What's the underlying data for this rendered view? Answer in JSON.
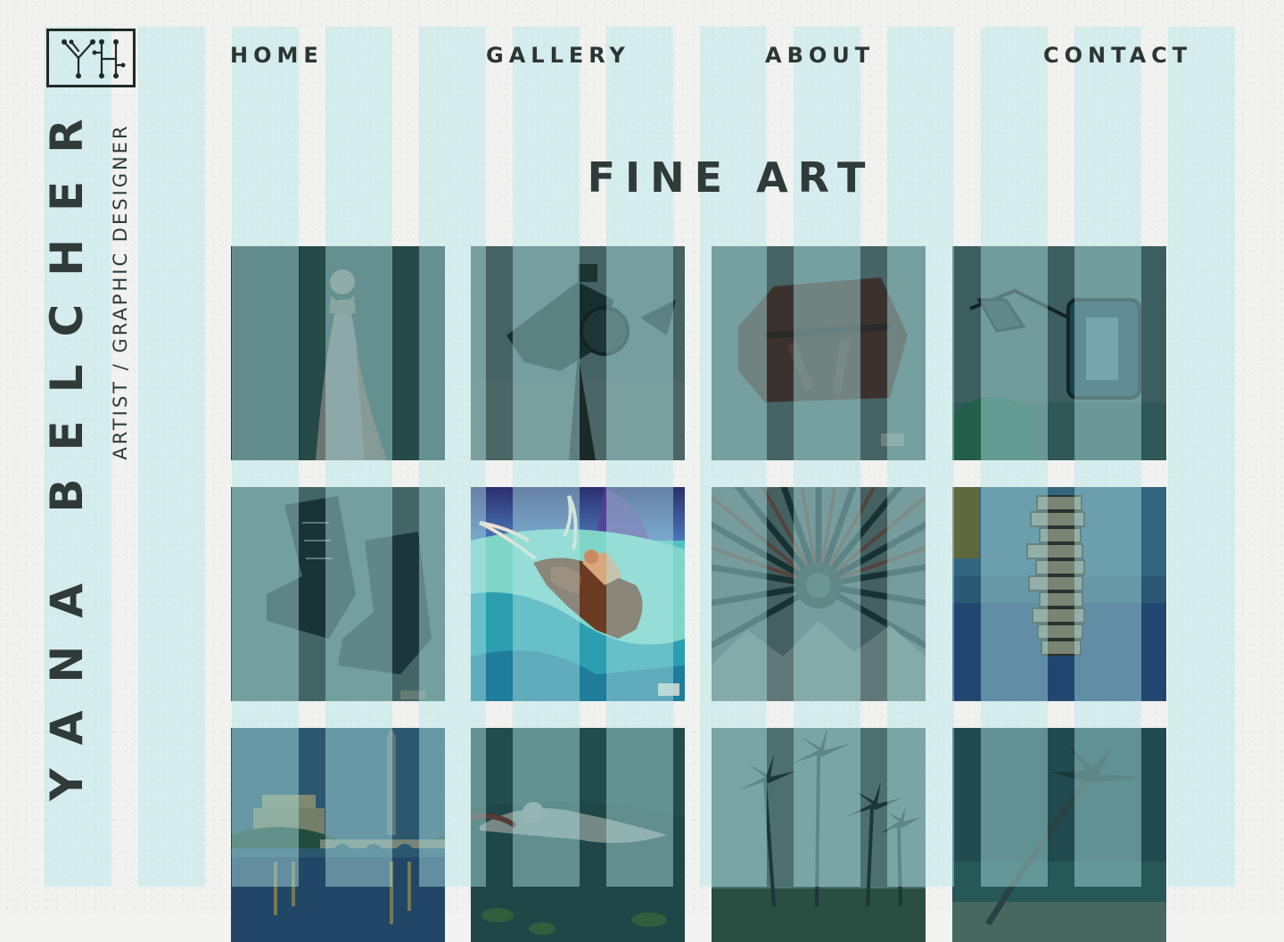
{
  "brand": {
    "name": "YANA BELCHER",
    "tagline": "ARTIST / GRAPHIC DESIGNER"
  },
  "nav": {
    "home": "HOME",
    "gallery": "GALLERY",
    "about": "ABOUT",
    "contact": "CONTACT"
  },
  "page": {
    "title": "FINE ART"
  },
  "colors": {
    "stripe": "#b2e6e6",
    "ink": "#2f3b3b",
    "tile_overlay": "#143c3e"
  },
  "gallery": {
    "tiles": [
      {
        "subject": "woman in gown"
      },
      {
        "subject": "camera"
      },
      {
        "subject": "leather bag"
      },
      {
        "subject": "kitchen mixer"
      },
      {
        "subject": "boots"
      },
      {
        "subject": "bull and rider"
      },
      {
        "subject": "sunburst over mountains"
      },
      {
        "subject": "stacked books"
      },
      {
        "subject": "monument and bridge"
      },
      {
        "subject": "floating woman"
      },
      {
        "subject": "palm trees"
      },
      {
        "subject": "leaning palm"
      }
    ]
  }
}
